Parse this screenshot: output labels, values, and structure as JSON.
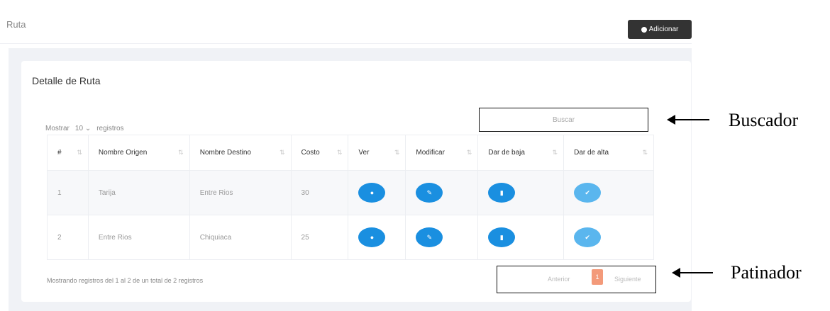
{
  "topbar": {
    "crumb": "Ruta",
    "add_button": "Adicionar"
  },
  "card": {
    "title": "Detalle de Ruta"
  },
  "length_menu": {
    "show": "Mostrar",
    "value": "10",
    "suffix": "registros"
  },
  "search": {
    "label": "Buscar"
  },
  "table": {
    "columns": [
      "#",
      "Nombre Origen",
      "Nombre Destino",
      "Costo",
      "Ver",
      "Modificar",
      "Dar de baja",
      "Dar de alta"
    ],
    "rows": [
      {
        "num": "1",
        "origen": "Tarija",
        "destino": "Entre Rios",
        "costo": "30"
      },
      {
        "num": "2",
        "origen": "Entre Rios",
        "destino": "Chiquiaca",
        "costo": "25"
      }
    ]
  },
  "info": "Mostrando registros del 1 al 2 de un total de 2 registros",
  "pagination": {
    "prev": "Anterior",
    "current": "1",
    "next": "Siguiente"
  },
  "annotations": {
    "search_label": "Buscador",
    "pager_label": "Patinador"
  },
  "colors": {
    "primary_button": "#1a8fe0",
    "light_button": "#5ab6ee",
    "page_active": "#f39a7a",
    "add_button": "#333333"
  },
  "icons": {
    "ver": "eye-icon",
    "modificar": "edit-icon",
    "baja": "down-icon",
    "alta": "check-icon"
  }
}
